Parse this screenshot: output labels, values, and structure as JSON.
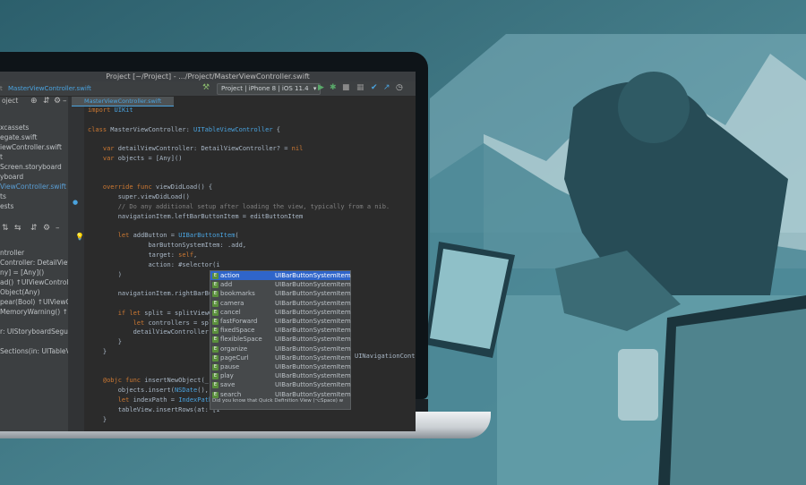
{
  "window": {
    "title": "Project [~/Project] - .../Project/MasterViewController.swift"
  },
  "toolbar": {
    "crumb_tail": "t",
    "file_name": "MasterViewController.swift",
    "run_config": "Project | iPhone 8 | iOS 11.4",
    "icons": [
      "hammer-icon",
      "run-icon",
      "debug-icon",
      "stop-icon",
      "build-icon",
      "check-icon",
      "history-icon"
    ]
  },
  "project_tree": {
    "header": "oject",
    "items": [
      {
        "label": "xcassets"
      },
      {
        "label": "egate.swift"
      },
      {
        "label": "iewController.swift"
      },
      {
        "label": "t"
      },
      {
        "label": "Screen.storyboard"
      },
      {
        "label": "yboard"
      },
      {
        "label": "ViewController.swift",
        "selected": true
      },
      {
        "label": "ts"
      },
      {
        "label": "ests"
      }
    ]
  },
  "structure": {
    "items": [
      {
        "label": "ntroller"
      },
      {
        "label": "Controller: DetailViewC"
      },
      {
        "label": "ny] = [Any]()"
      },
      {
        "label": "ad() ↑UIViewController"
      },
      {
        "label": "Object(Any)"
      },
      {
        "label": "pear(Bool) ↑UIViewCo"
      },
      {
        "label": "MemoryWarning() ↑UI"
      },
      {
        "label": "r: UIStoryboardSegue,"
      },
      {
        "label": "Sections(in: UITableVie"
      }
    ]
  },
  "editor": {
    "tab_label": "MasterViewController.swift",
    "lines": [
      "import UIKit",
      "",
      "class MasterViewController: UITableViewController {",
      "",
      "    var detailViewController: DetailViewController? = nil",
      "    var objects = [Any]()",
      "",
      "",
      "    override func viewDidLoad() {",
      "        super.viewDidLoad()",
      "        // Do any additional setup after loading the view, typically from a nib.",
      "        navigationItem.leftBarButtonItem = editButtonItem",
      "",
      "        let addButton = UIBarButtonItem(",
      "                barButtonSystemItem: .add,",
      "                target: self,",
      "                action: #selector(i",
      "        )",
      "",
      "        navigationItem.rightBarBut",
      "",
      "        if let split = splitViewCo",
      "            let controllers = split",
      "            detailViewController = ",
      "        }",
      "    }",
      "",
      "",
      "    @objc func insertNewObject(_ se",
      "        objects.insert(NSDate(), at",
      "        let indexPath = IndexPath(r",
      "        tableView.insertRows(at: [i",
      "    }"
    ],
    "overflow_text": "UINavigationContr"
  },
  "completion": {
    "items": [
      {
        "name": "action",
        "type": "UIBarButtonSystemItem",
        "active": true
      },
      {
        "name": "add",
        "type": "UIBarButtonSystemItem"
      },
      {
        "name": "bookmarks",
        "type": "UIBarButtonSystemItem"
      },
      {
        "name": "camera",
        "type": "UIBarButtonSystemItem"
      },
      {
        "name": "cancel",
        "type": "UIBarButtonSystemItem"
      },
      {
        "name": "fastForward",
        "type": "UIBarButtonSystemItem"
      },
      {
        "name": "fixedSpace",
        "type": "UIBarButtonSystemItem"
      },
      {
        "name": "flexibleSpace",
        "type": "UIBarButtonSystemItem"
      },
      {
        "name": "organize",
        "type": "UIBarButtonSystemItem"
      },
      {
        "name": "pageCurl",
        "type": "UIBarButtonSystemItem"
      },
      {
        "name": "pause",
        "type": "UIBarButtonSystemItem"
      },
      {
        "name": "play",
        "type": "UIBarButtonSystemItem"
      },
      {
        "name": "save",
        "type": "UIBarButtonSystemItem"
      },
      {
        "name": "search",
        "type": "UIBarButtonSystemItem"
      }
    ],
    "hint": "Did you know that Quick Definition View (⌥Space) w",
    "item_badge": "E"
  },
  "colors": {
    "background_teal": "#3f7f8c",
    "selection_blue": "#2f65ca",
    "keyword_orange": "#cc7832",
    "type_blue": "#4aa3df"
  }
}
